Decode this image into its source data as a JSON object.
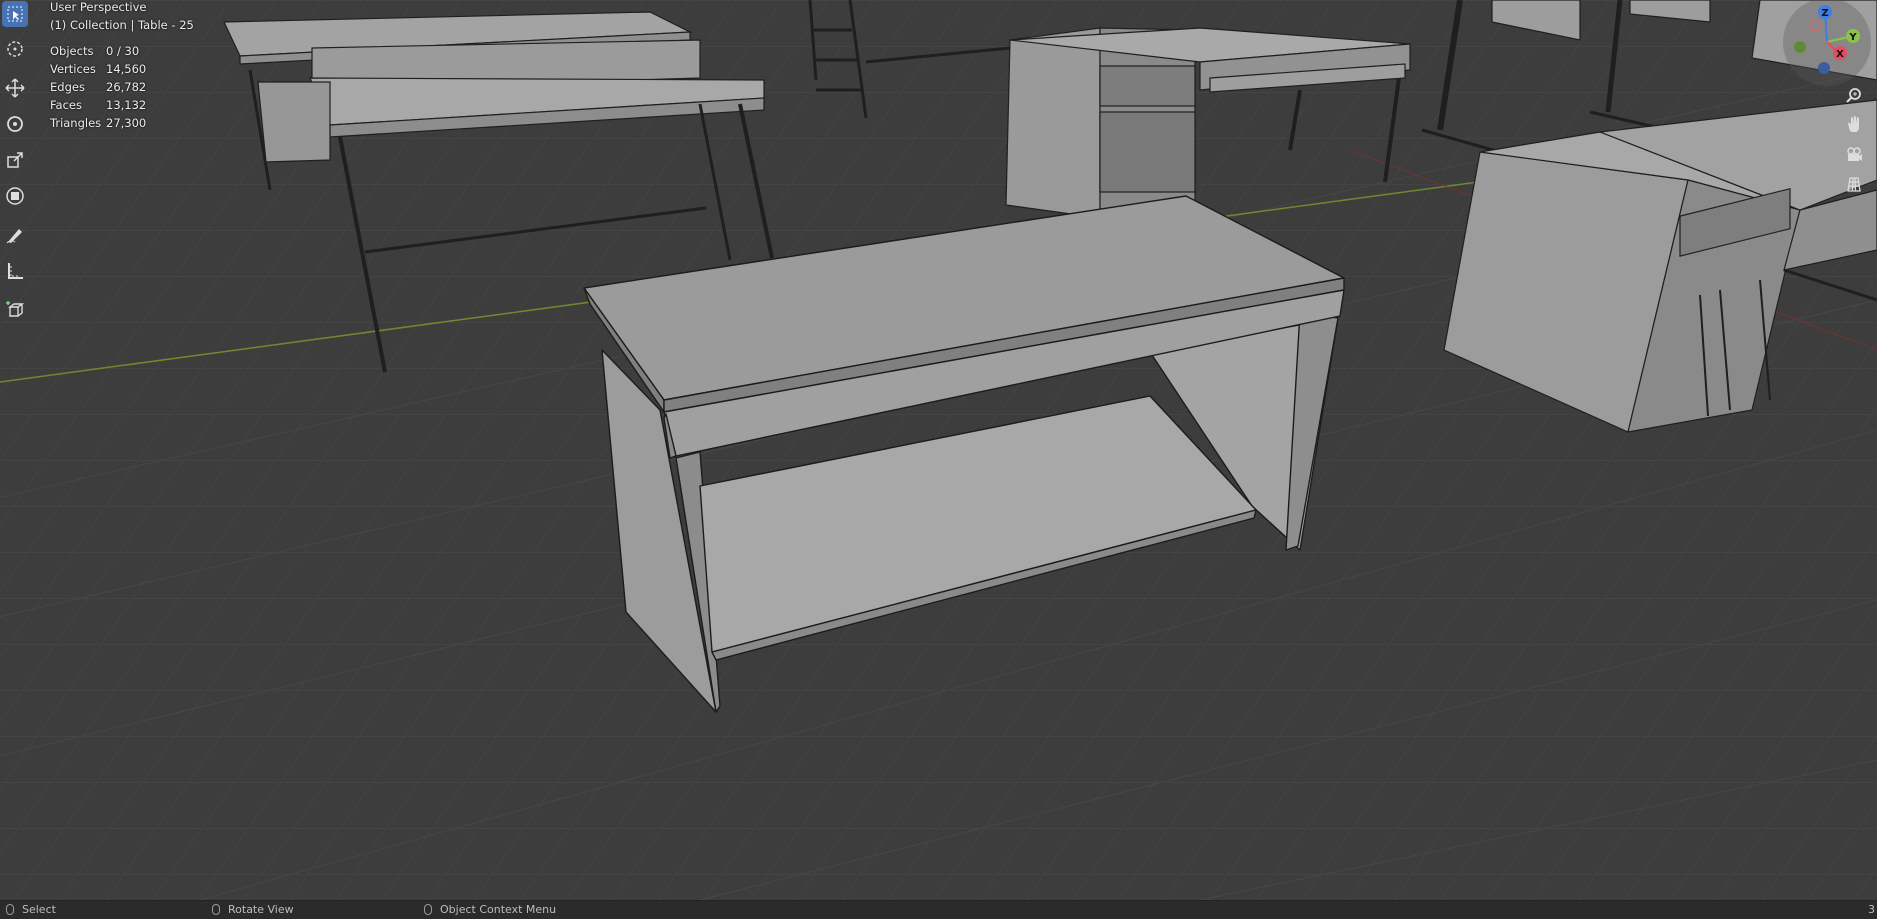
{
  "viewport": {
    "view_name": "User Perspective",
    "collection_label": "(1) Collection | Table - 25",
    "stats": [
      {
        "key": "Objects",
        "value": "0 / 30"
      },
      {
        "key": "Vertices",
        "value": "14,560"
      },
      {
        "key": "Edges",
        "value": "26,782"
      },
      {
        "key": "Faces",
        "value": "13,132"
      },
      {
        "key": "Triangles",
        "value": "27,300"
      }
    ]
  },
  "toolbar": {
    "tools": [
      "select-box",
      "cursor",
      "move",
      "rotate",
      "scale",
      "transform",
      "annotate",
      "measure",
      "add-cube"
    ],
    "active_tool": "select-box"
  },
  "gizmo": {
    "axes": {
      "z": "Z",
      "y": "Y",
      "x": "X"
    },
    "colors": {
      "x": "#e84a5f",
      "y": "#8bc34a",
      "z": "#3f7fe0"
    }
  },
  "nav_buttons": [
    "zoom-icon",
    "hand-pan-icon",
    "camera-icon",
    "grid-view-icon"
  ],
  "statusbar": {
    "select_label": "Select",
    "rotate_label": "Rotate View",
    "context_label": "Object Context Menu",
    "right_text": "3"
  },
  "colors": {
    "background": "#3d3d3d",
    "grid": "#4a4a4a",
    "x_axis_line": "#8c2d2d",
    "y_axis_line": "#6f8a2e",
    "mesh_fill": "#a6a6a6",
    "active_tool": "#4772b3"
  }
}
